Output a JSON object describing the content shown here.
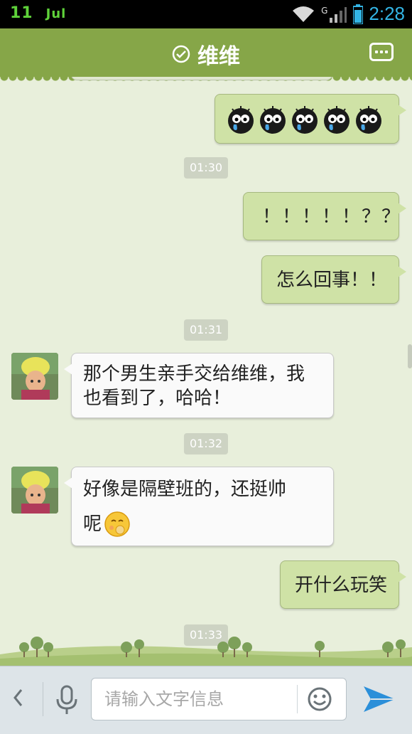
{
  "status_bar": {
    "date_day": "11",
    "date_month": "Jul",
    "time": "2:28",
    "network_label": "G"
  },
  "header": {
    "title": "维维"
  },
  "messages": [
    {
      "side": "right",
      "text": ""
    },
    {
      "time": "01:30"
    },
    {
      "side": "right",
      "text": "！！！！！？？"
    },
    {
      "side": "right",
      "text": "怎么回事！！"
    },
    {
      "time": "01:31"
    },
    {
      "side": "left",
      "text": "那个男生亲手交给维维，我也看到了，哈哈！"
    },
    {
      "time": "01:32"
    },
    {
      "side": "left",
      "text": "好像是隔壁班的，还挺帅呢"
    },
    {
      "side": "right",
      "text": "开什么玩笑"
    },
    {
      "time": "01:33"
    }
  ],
  "chat": {
    "t1": "01:30",
    "m1": "！！！！！？？",
    "m2": "怎么回事！！",
    "t2": "01:31",
    "m3_line1": "那个男生亲手交给维维，我",
    "m3_line2": "也看到了，哈哈！",
    "t3": "01:32",
    "m4_line1": "好像是隔壁班的，还挺帅",
    "m4_line2": "呢",
    "m5": "开什么玩笑",
    "t4": "01:33"
  },
  "input": {
    "placeholder": "请输入文字信息"
  },
  "colors": {
    "title_bar": "#86a648",
    "background": "#e8efdb",
    "my_bubble": "#cfe2a6",
    "their_bubble": "#fafafa",
    "send_icon": "#2b8fd9"
  }
}
